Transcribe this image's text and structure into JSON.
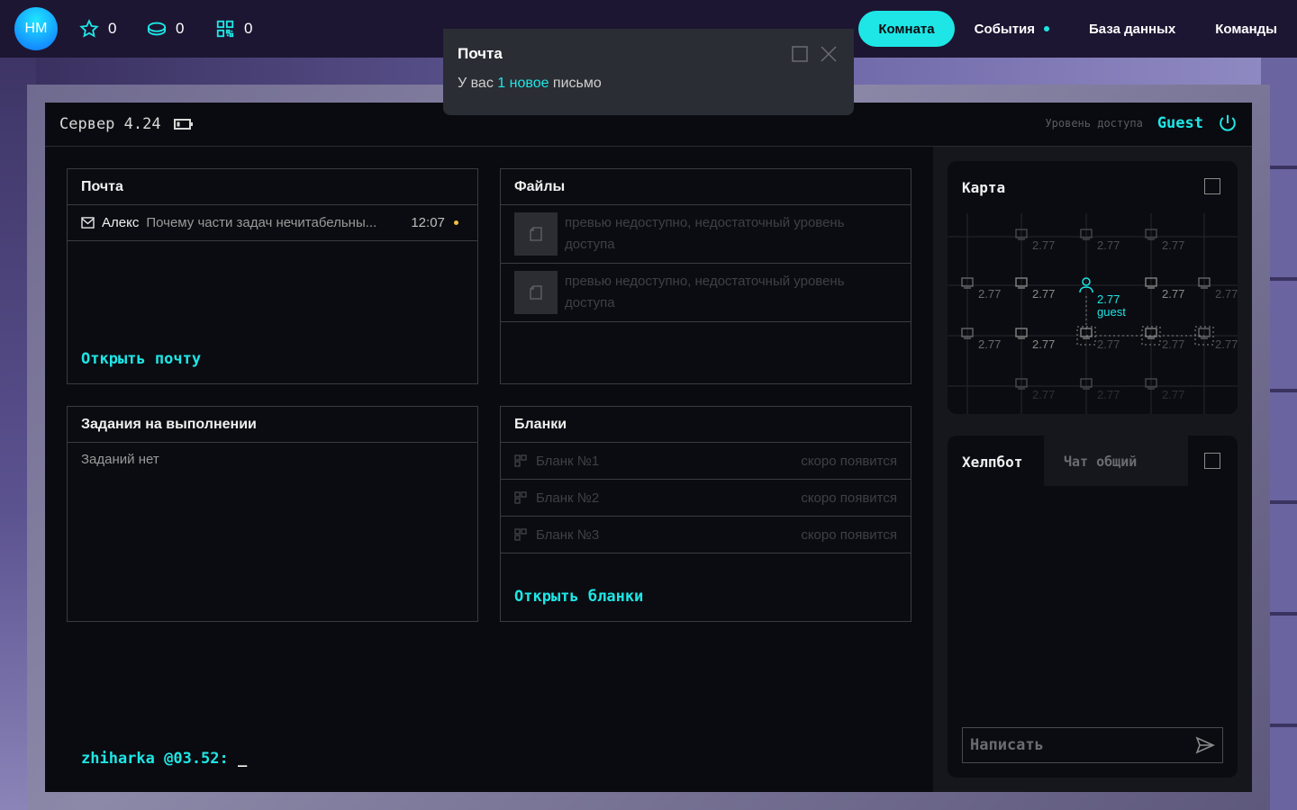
{
  "user": {
    "initials": "HM",
    "stars": "0",
    "coins": "0",
    "codes": "0"
  },
  "nav": {
    "items": [
      "Комната",
      "События",
      "База данных",
      "Команды"
    ]
  },
  "popup": {
    "title": "Почта",
    "text_before": "У вас ",
    "count": "1",
    "text_new": " новое",
    "text_after": " письмо"
  },
  "server": {
    "title": "Сервер 4.24",
    "access_label": "Уровень доступа",
    "access_level": "Guest"
  },
  "mail": {
    "title": "Почта",
    "row": {
      "from": "Алекс",
      "subject": "Почему части задач нечитабельны...",
      "time": "12:07"
    },
    "open_link": "Открыть почту"
  },
  "files": {
    "title": "Файлы",
    "items": [
      {
        "text": "превью недоступно, недостаточный уровень доступа"
      },
      {
        "text": "превью недоступно, недостаточный уровень доступа"
      }
    ]
  },
  "tasks": {
    "title": "Задания на выполнении",
    "empty": "Заданий нет"
  },
  "forms": {
    "title": "Бланки",
    "items": [
      {
        "name": "Бланк №1",
        "status": "скоро появится"
      },
      {
        "name": "Бланк №2",
        "status": "скоро появится"
      },
      {
        "name": "Бланк №3",
        "status": "скоро появится"
      }
    ],
    "open_link": "Открыть бланки"
  },
  "prompt": {
    "text": "zhiharka @03.52: ",
    "cursor": "_"
  },
  "map": {
    "title": "Карта",
    "node_value": "2.77",
    "user_label": "guest"
  },
  "chat": {
    "tab_bot": "Хелпбот",
    "tab_general": "Чат общий",
    "placeholder": "Написать"
  },
  "colors": {
    "accent": "#1ee6e6",
    "unread": "#f0c040",
    "background": "#0a0b10"
  }
}
